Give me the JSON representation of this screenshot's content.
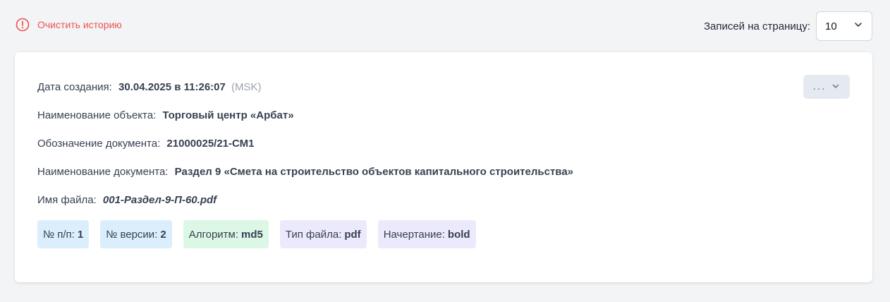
{
  "header": {
    "clear_history_label": "Очистить историю",
    "per_page_label": "Записей на страницу:",
    "per_page_value": "10"
  },
  "record": {
    "menu_label": "...",
    "created": {
      "label": "Дата создания:",
      "value": "30.04.2025 в 11:26:07",
      "timezone": "(MSK)"
    },
    "object_name": {
      "label": "Наименование объекта:",
      "value": "Торговый центр «Арбат»"
    },
    "doc_code": {
      "label": "Обозначение документа:",
      "value": "21000025/21-СМ1"
    },
    "doc_name": {
      "label": "Наименование документа:",
      "value": "Раздел 9 «Смета на строительство объектов капитального строительства»"
    },
    "file_name": {
      "label": "Имя файла:",
      "value": "001-Раздел-9-П-60.pdf"
    },
    "tags": [
      {
        "label": "№ п/п:",
        "value": "1",
        "color": "#dbeefc"
      },
      {
        "label": "№ версии:",
        "value": "2",
        "color": "#dbeefc"
      },
      {
        "label": "Алгоритм:",
        "value": "md5",
        "color": "#dcf7e6"
      },
      {
        "label": "Тип файла:",
        "value": "pdf",
        "color": "#ece9fc"
      },
      {
        "label": "Начертание:",
        "value": "bold",
        "color": "#ece9fc"
      }
    ]
  },
  "colors": {
    "danger": "#ef5350",
    "background": "#f3f4f6",
    "card": "#ffffff",
    "menu_button": "#e5e9f0"
  }
}
